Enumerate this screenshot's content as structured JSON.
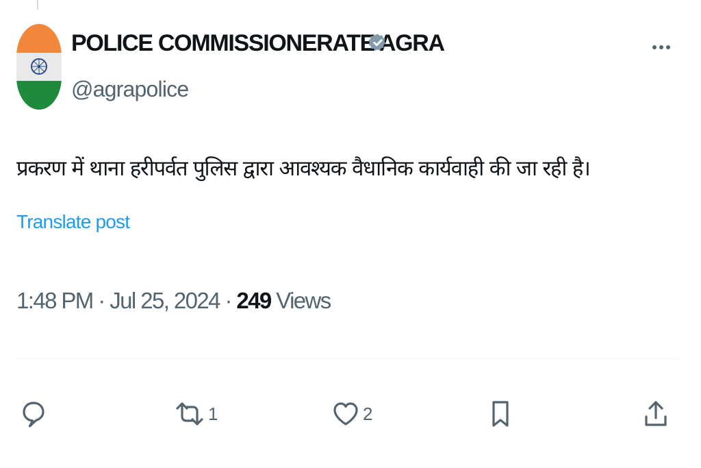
{
  "author": {
    "display_name": "POLICE COMMISSIONERATE AGRA",
    "handle": "@agrapolice",
    "verified": true,
    "avatar": "indian-flag-avatar"
  },
  "post": {
    "text": "प्रकरण में थाना हरीपर्वत पुलिस द्वारा आवश्यक वैधानिक कार्यवाही की जा रही है।",
    "translate_label": "Translate post",
    "time": "1:48 PM",
    "date": "Jul 25, 2024",
    "separator": "·",
    "views_count": "249",
    "views_label": "Views"
  },
  "actions": {
    "reply": {
      "icon": "reply-icon",
      "count": ""
    },
    "repost": {
      "icon": "repost-icon",
      "count": "1"
    },
    "like": {
      "icon": "heart-icon",
      "count": "2"
    },
    "bookmark": {
      "icon": "bookmark-icon"
    },
    "share": {
      "icon": "share-icon"
    }
  },
  "colors": {
    "text_primary": "#0f1419",
    "text_secondary": "#536471",
    "link": "#1d9bf0",
    "verified_badge": "#829aab",
    "divider": "#eff3f4"
  }
}
